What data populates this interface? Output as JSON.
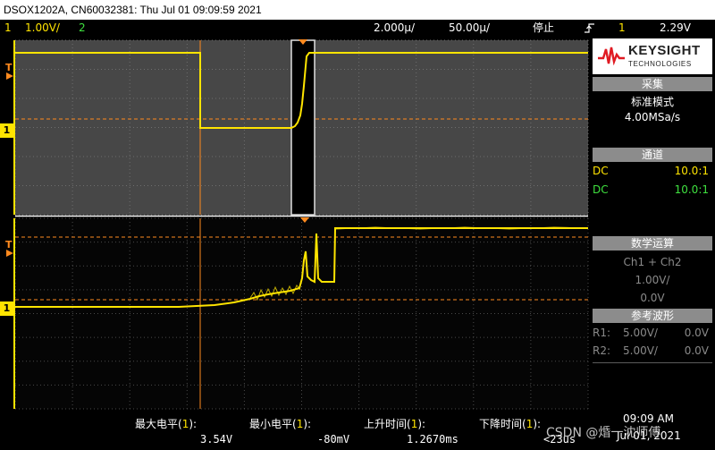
{
  "title_bar": {
    "text": "DSOX1202A, CN60032381: Thu Jul 01 09:09:59 2021"
  },
  "status_bar": {
    "ch1_number": "1",
    "ch1_scale": "1.00V/",
    "ch2_number": "2",
    "timebase_1": "2.000µ/",
    "timebase_2": "50.00µ/",
    "run_state": "停止",
    "trigger_icon": "trigger-edge-icon",
    "trigger_channel": "1",
    "trigger_level": "2.29V"
  },
  "screen": {
    "ch1_marker": "1",
    "trigger_marker": "T"
  },
  "side_panel": {
    "brand_line1": "KEYSIGHT",
    "brand_line2": "TECHNOLOGIES",
    "acquire_header": "采集",
    "acquire_mode": "标准模式",
    "sample_rate": "4.00MSa/s",
    "channel_header": "通道",
    "ch1_coupling": "DC",
    "ch1_probe": "10.0:1",
    "ch2_coupling": "DC",
    "ch2_probe": "10.0:1",
    "math_header": "数学运算",
    "math_func": "Ch1 + Ch2",
    "math_scale": "1.00V/",
    "math_offset": "0.0V",
    "ref_header": "参考波形",
    "r1_label": "R1:",
    "r1_scale": "5.00V/",
    "r1_offset": "0.0V",
    "r2_label": "R2:",
    "r2_scale": "5.00V/",
    "r2_offset": "0.0V"
  },
  "measurements": [
    {
      "label": "最大电平(",
      "ch": "1",
      "close": "):",
      "value": "3.54V"
    },
    {
      "label": "最小电平(",
      "ch": "1",
      "close": "):",
      "value": "-80mV"
    },
    {
      "label": "上升时间(",
      "ch": "1",
      "close": "):",
      "value": "1.2670ms"
    },
    {
      "label": "下降时间(",
      "ch": "1",
      "close": "):",
      "value": "<23us"
    }
  ],
  "clock": {
    "time": "09:09 AM",
    "date": "Jul 01, 2021"
  },
  "watermark": "CSDN @焝一沈师傅",
  "colors": {
    "ch1": "#ffe400",
    "ch2": "#3fe03f",
    "trigger": "#ff8a1e",
    "panel_header": "#8c8c8c"
  }
}
